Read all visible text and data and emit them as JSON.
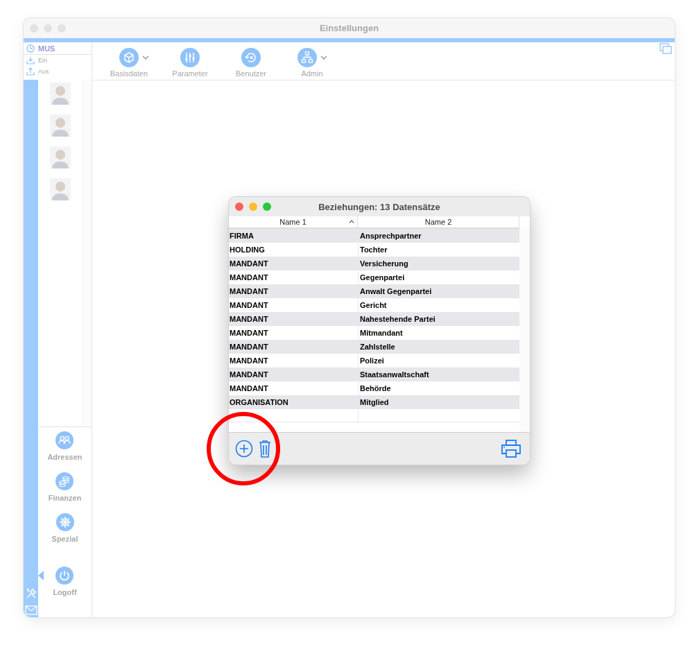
{
  "window": {
    "title": "Einstellungen"
  },
  "user": {
    "code": "MUS",
    "actions": [
      "Ein",
      "Aus"
    ]
  },
  "toolbar": [
    {
      "label": "Basisdaten",
      "menu": true
    },
    {
      "label": "Parameter",
      "menu": false
    },
    {
      "label": "Benutzer",
      "menu": false
    },
    {
      "label": "Admin",
      "menu": true
    }
  ],
  "nav": [
    {
      "label": "Adressen"
    },
    {
      "label": "Finanzen"
    },
    {
      "label": "Spezial"
    },
    {
      "label": "Logoff"
    }
  ],
  "dialog": {
    "title": "Beziehungen: 13 Datensätze",
    "columns": [
      "Name 1",
      "Name 2"
    ],
    "rows": [
      [
        "FIRMA",
        "Ansprechpartner"
      ],
      [
        "HOLDING",
        "Tochter"
      ],
      [
        "MANDANT",
        "Versicherung"
      ],
      [
        "MANDANT",
        "Gegenpartei"
      ],
      [
        "MANDANT",
        "Anwalt Gegenpartei"
      ],
      [
        "MANDANT",
        "Gericht"
      ],
      [
        "MANDANT",
        "Nahestehende Partei"
      ],
      [
        "MANDANT",
        "Mitmandant"
      ],
      [
        "MANDANT",
        "Zahlstelle"
      ],
      [
        "MANDANT",
        "Polizei"
      ],
      [
        "MANDANT",
        "Staatsanwaltschaft"
      ],
      [
        "MANDANT",
        "Behörde"
      ],
      [
        "ORGANISATION",
        "Mitglied"
      ]
    ]
  }
}
